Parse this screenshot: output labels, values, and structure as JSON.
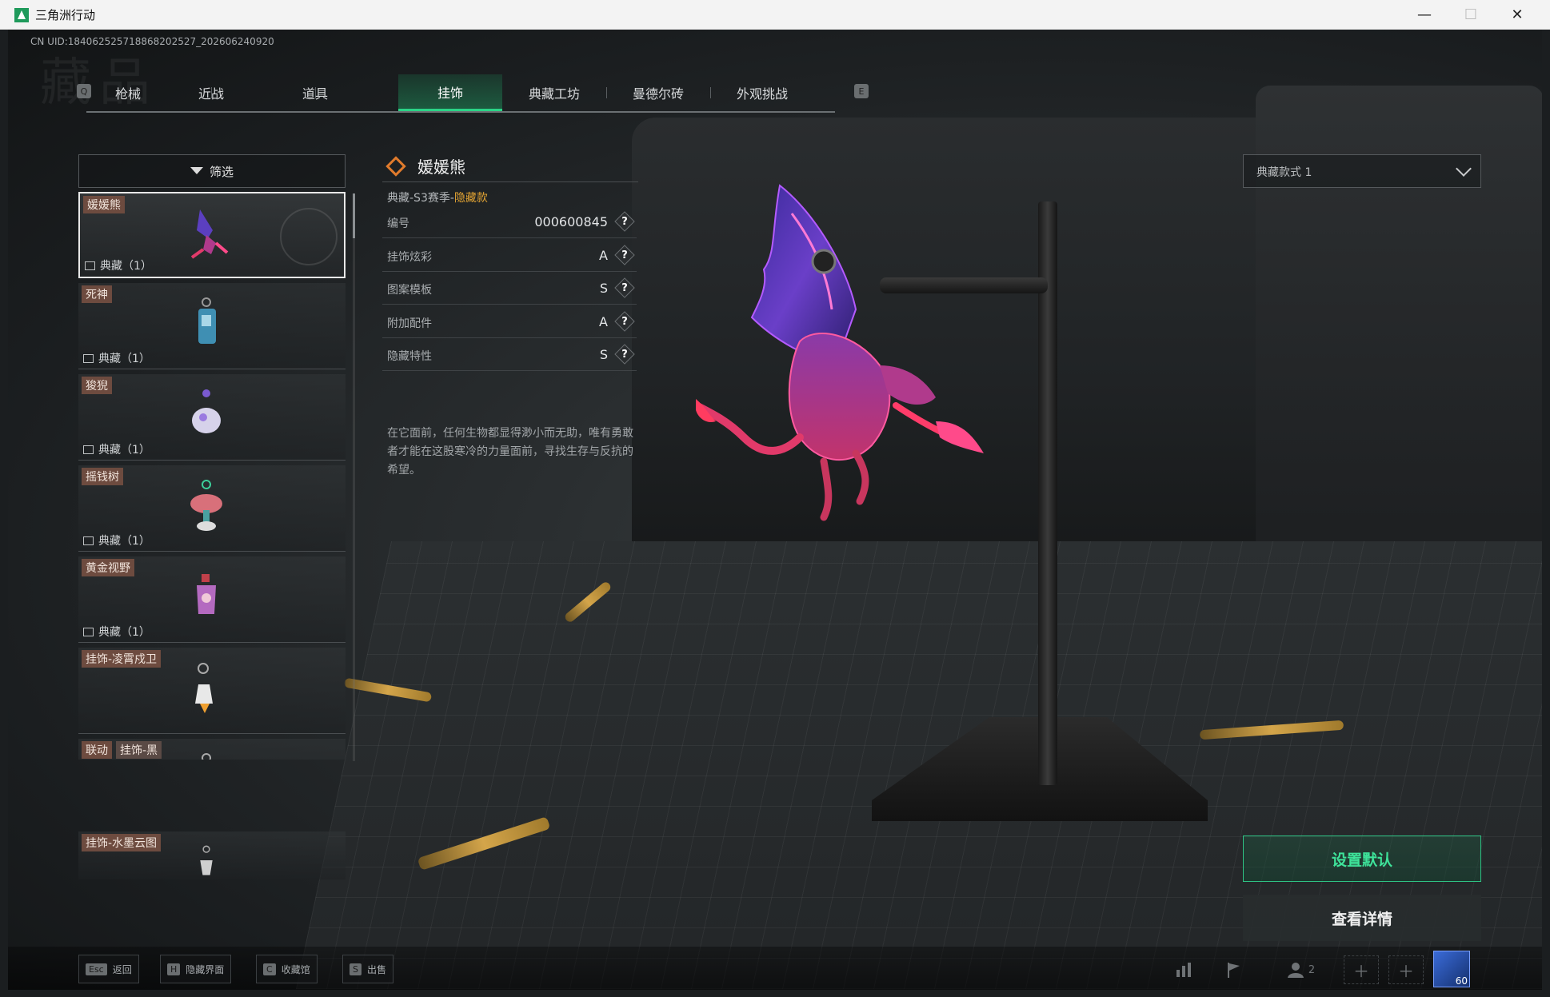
{
  "window": {
    "title": "三角洲行动",
    "minimize": "—",
    "maximize": "☐",
    "close": "✕"
  },
  "header": {
    "uid": "CN UID:184062525718868202527_202606240920",
    "bg_title": "藏品"
  },
  "tabs": {
    "left_key": "Q",
    "right_key": "E",
    "items": [
      {
        "label": "枪械"
      },
      {
        "label": "近战"
      },
      {
        "label": "道具"
      },
      {
        "label": "挂饰"
      },
      {
        "label": "典藏工坊"
      },
      {
        "label": "曼德尔砖"
      },
      {
        "label": "外观挑战"
      }
    ],
    "active": "挂饰"
  },
  "filter": {
    "label": "筛选"
  },
  "list": {
    "items": [
      {
        "name": "媛媛熊",
        "collection": "典藏（1）",
        "selected": true
      },
      {
        "name": "死神",
        "collection": "典藏（1）"
      },
      {
        "name": "狻猊",
        "collection": "典藏（1）"
      },
      {
        "name": "摇钱树",
        "collection": "典藏（1）"
      },
      {
        "name": "黄金视野",
        "collection": "典藏（1）"
      },
      {
        "name": "挂饰-凌霄戍卫",
        "collection": ""
      },
      {
        "tag": "联动",
        "name": "挂饰-黑",
        "collection": ""
      },
      {
        "name": "挂饰-水墨云图",
        "collection": ""
      }
    ]
  },
  "detail": {
    "name": "媛媛熊",
    "season_prefix": "典藏-S3赛季-",
    "season_highlight": "隐藏款",
    "attributes": [
      {
        "key": "编号",
        "value": "000600845"
      },
      {
        "key": "挂饰炫彩",
        "value": "A"
      },
      {
        "key": "图案模板",
        "value": "S"
      },
      {
        "key": "附加配件",
        "value": "A"
      },
      {
        "key": "隐藏特性",
        "value": "S"
      }
    ],
    "help_glyph": "?",
    "description": "在它面前，任何生物都显得渺小而无助，唯有勇敢者才能在这股寒冷的力量面前，寻找生存与反抗的希望。"
  },
  "style_select": {
    "value": "典藏款式 1"
  },
  "actions": {
    "set_default": "设置默认",
    "view_details": "查看详情"
  },
  "footer": {
    "hotkeys": [
      {
        "key": "Esc",
        "label": "返回"
      },
      {
        "key": "H",
        "label": "隐藏界面"
      },
      {
        "key": "C",
        "label": "收藏馆"
      },
      {
        "key": "S",
        "label": "出售"
      }
    ],
    "squad_count": "2",
    "level": "60"
  },
  "colors": {
    "accent_green": "#2bd487",
    "tag_bg": "#6d4b3f",
    "highlight_gold": "#e2a333"
  }
}
